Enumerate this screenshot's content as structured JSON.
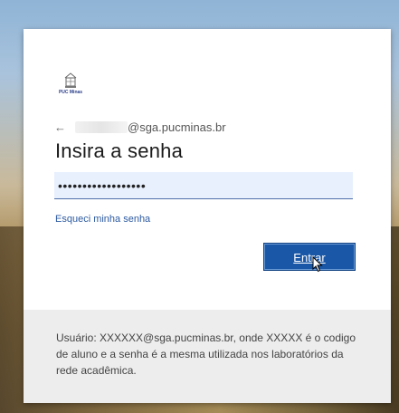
{
  "logo": {
    "text": "PUC Minas",
    "icon": "puc-minas-crest-icon"
  },
  "identity": {
    "back_icon": "arrow-left-icon",
    "email_suffix": "@sga.pucminas.br"
  },
  "title": "Insira a senha",
  "password": {
    "value": "••••••••••••••••••"
  },
  "forgot_link": "Esqueci minha senha",
  "signin_button": {
    "label": "Entrar"
  },
  "footer": {
    "text": "Usuário: XXXXXX@sga.pucminas.br, onde XXXXX é o codigo de aluno e a senha é a mesma utilizada nos laboratórios da rede acadêmica."
  },
  "colors": {
    "accent": "#1a57a6",
    "link": "#2c5aa0",
    "input_bg": "#e8f0fe",
    "footer_bg": "#ededed"
  }
}
